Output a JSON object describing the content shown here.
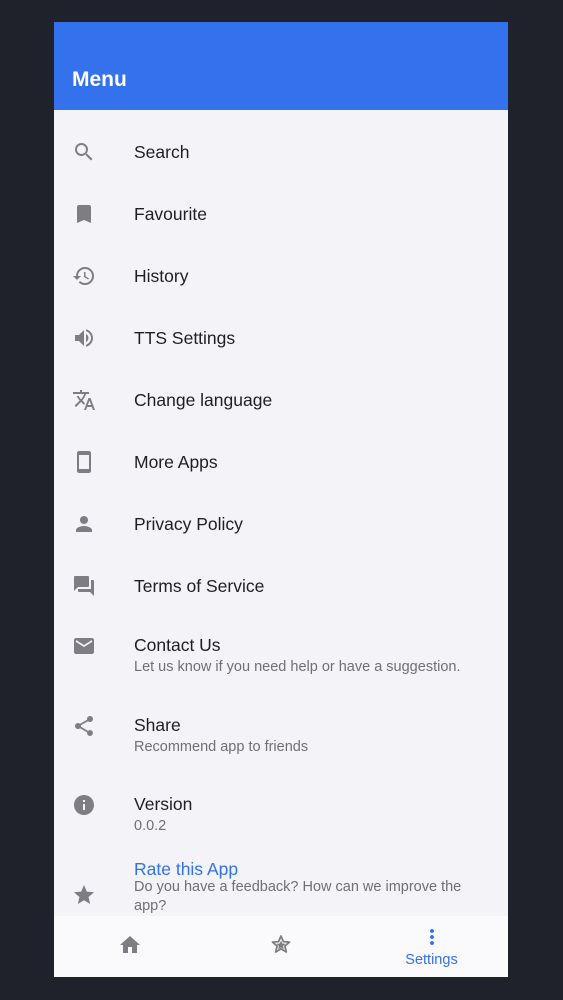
{
  "header": {
    "title": "Menu",
    "color": "#3471ec"
  },
  "menu": {
    "items": [
      {
        "icon": "search-icon",
        "title": "Search"
      },
      {
        "icon": "bookmark-icon",
        "title": "Favourite"
      },
      {
        "icon": "history-icon",
        "title": "History"
      },
      {
        "icon": "volume-icon",
        "title": "TTS Settings"
      },
      {
        "icon": "translate-icon",
        "title": "Change language"
      },
      {
        "icon": "smartphone-icon",
        "title": "More Apps"
      },
      {
        "icon": "person-icon",
        "title": "Privacy Policy"
      },
      {
        "icon": "forum-icon",
        "title": "Terms of Service"
      },
      {
        "icon": "mail-icon",
        "title": "Contact Us",
        "subtitle": "Let us know if you need help or have a suggestion."
      },
      {
        "icon": "share-icon",
        "title": "Share",
        "subtitle": "Recommend app to friends"
      },
      {
        "icon": "info-icon",
        "title": "Version",
        "subtitle": "0.0.2"
      },
      {
        "icon": "star-icon",
        "title": "Rate this App",
        "subtitle": "Do you have a feedback? How can we improve the app?"
      }
    ]
  },
  "bottom_nav": {
    "items": [
      {
        "icon": "home-icon",
        "label": ""
      },
      {
        "icon": "stars-icon",
        "label": ""
      },
      {
        "icon": "more-vert-icon",
        "label": "Settings",
        "active": true
      }
    ],
    "active_color": "#3471ec"
  }
}
